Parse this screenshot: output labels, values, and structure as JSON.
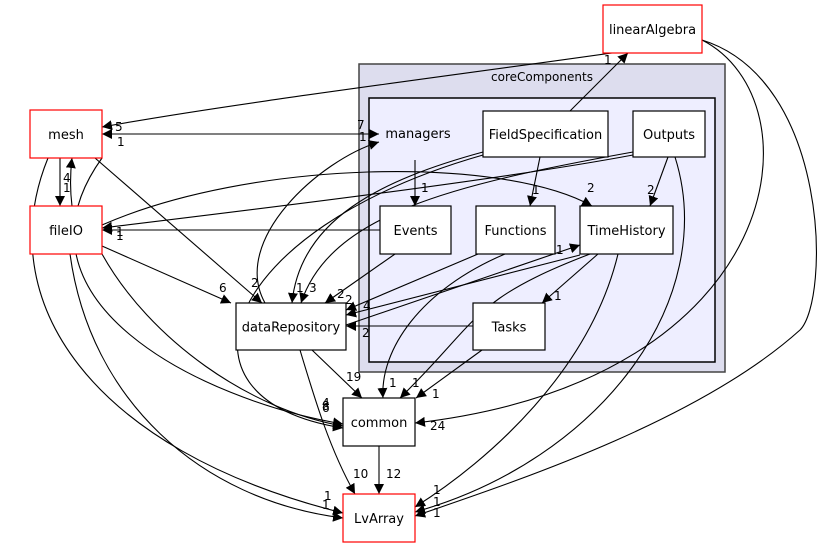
{
  "colors": {
    "cluster_outer": "#ddddee",
    "cluster_inner": "#eeeeff",
    "external_border": "#ff0000",
    "node_border": "#000000"
  },
  "clusters": {
    "outer_label": "coreComponents",
    "inner_label": "managers"
  },
  "nodes": {
    "linearAlgebra": {
      "label": "linearAlgebra",
      "external": true
    },
    "mesh": {
      "label": "mesh",
      "external": true
    },
    "fileIO": {
      "label": "fileIO",
      "external": true
    },
    "FieldSpecification": {
      "label": "FieldSpecification",
      "external": false
    },
    "Outputs": {
      "label": "Outputs",
      "external": false
    },
    "Events": {
      "label": "Events",
      "external": false
    },
    "Functions": {
      "label": "Functions",
      "external": false
    },
    "TimeHistory": {
      "label": "TimeHistory",
      "external": false
    },
    "Tasks": {
      "label": "Tasks",
      "external": false
    },
    "dataRepository": {
      "label": "dataRepository",
      "external": false
    },
    "common": {
      "label": "common",
      "external": false
    },
    "LvArray": {
      "label": "LvArray",
      "external": true
    }
  },
  "edges": [
    {
      "from": "linearAlgebra",
      "to": "mesh",
      "label": "5"
    },
    {
      "from": "mesh",
      "to": "managers",
      "label": "7"
    },
    {
      "from": "managers",
      "to": "mesh",
      "label": "1"
    },
    {
      "from": "mesh",
      "to": "fileIO",
      "label": "4"
    },
    {
      "from": "fileIO",
      "to": "mesh",
      "label": "1"
    },
    {
      "from": "mesh",
      "to": "dataRepository",
      "label": "2"
    },
    {
      "from": "fileIO",
      "to": "dataRepository",
      "label": "6"
    },
    {
      "from": "dataRepository",
      "to": "managers",
      "label": "1"
    },
    {
      "from": "Events",
      "to": "fileIO",
      "label": "1"
    },
    {
      "from": "Outputs",
      "to": "fileIO",
      "label": "1"
    },
    {
      "from": "FieldSpecification",
      "to": "linearAlgebra",
      "label": "1"
    },
    {
      "from": "managers",
      "to": "Events",
      "label": "1"
    },
    {
      "from": "FieldSpecification",
      "to": "Functions",
      "label": "1"
    },
    {
      "from": "Outputs",
      "to": "TimeHistory",
      "label": "2"
    },
    {
      "from": "fileIO",
      "to": "TimeHistory",
      "label": "2"
    },
    {
      "from": "FieldSpecification",
      "to": "dataRepository",
      "label": "1"
    },
    {
      "from": "Outputs",
      "to": "dataRepository",
      "label": "3"
    },
    {
      "from": "Events",
      "to": "dataRepository",
      "label": "2"
    },
    {
      "from": "Functions",
      "to": "dataRepository",
      "label": "2"
    },
    {
      "from": "TimeHistory",
      "to": "dataRepository",
      "label": "4"
    },
    {
      "from": "dataRepository",
      "to": "TimeHistory",
      "label": "1"
    },
    {
      "from": "Tasks",
      "to": "dataRepository",
      "label": "2"
    },
    {
      "from": "TimeHistory",
      "to": "Tasks",
      "label": "1"
    },
    {
      "from": "dataRepository",
      "to": "common",
      "label": "19"
    },
    {
      "from": "Functions",
      "to": "common",
      "label": "1"
    },
    {
      "from": "TimeHistory",
      "to": "common",
      "label": "1"
    },
    {
      "from": "Tasks",
      "to": "common",
      "label": "1"
    },
    {
      "from": "mesh",
      "to": "common",
      "label": "4"
    },
    {
      "from": "fileIO",
      "to": "common",
      "label": "6"
    },
    {
      "from": "FieldSpecification",
      "to": "common",
      "label": "8"
    },
    {
      "from": "linearAlgebra",
      "to": "common",
      "label": "24"
    },
    {
      "from": "common",
      "to": "LvArray",
      "label": "12"
    },
    {
      "from": "dataRepository",
      "to": "LvArray",
      "label": "10"
    },
    {
      "from": "mesh",
      "to": "LvArray",
      "label": "1"
    },
    {
      "from": "fileIO",
      "to": "LvArray",
      "label": "1"
    },
    {
      "from": "TimeHistory",
      "to": "LvArray",
      "label": "1"
    },
    {
      "from": "Outputs",
      "to": "LvArray",
      "label": "1"
    },
    {
      "from": "linearAlgebra",
      "to": "LvArray",
      "label": "1"
    }
  ]
}
